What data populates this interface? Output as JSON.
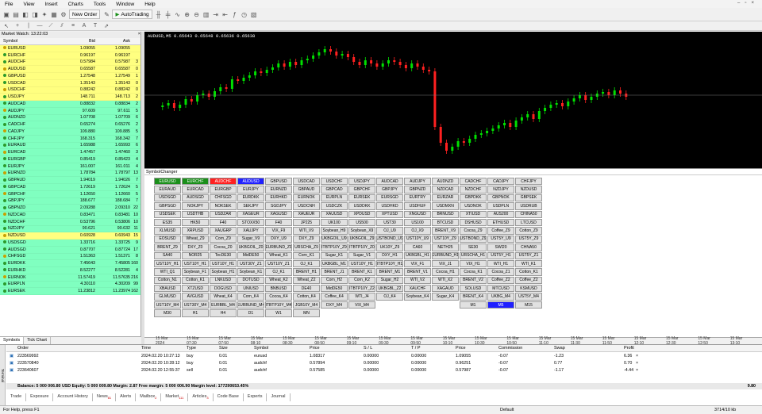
{
  "menu": [
    "File",
    "View",
    "Insert",
    "Charts",
    "Tools",
    "Window",
    "Help"
  ],
  "toolbar": {
    "new_order": "New Order",
    "autotrading": "AutoTrading"
  },
  "market_watch": {
    "title": "Market Watch: 13:22:03",
    "cols": [
      "Symbol",
      "Bid",
      "Ask",
      ""
    ],
    "rows": [
      [
        "EURUSD",
        "1.09055",
        "1.09055",
        "",
        "#ffff80"
      ],
      [
        "EURCHF",
        "0.96197",
        "0.96197",
        "",
        "#ffff80"
      ],
      [
        "AUDCHF",
        "0.57984",
        "0.57987",
        "3",
        "#ffff80"
      ],
      [
        "AUDUSD",
        "0.65587",
        "0.65587",
        "0",
        "#ffff80"
      ],
      [
        "GBPUSD",
        "1.27548",
        "1.27549",
        "1",
        "#ffff80"
      ],
      [
        "USDCAD",
        "1.35143",
        "1.35143",
        "0",
        "#ffff80"
      ],
      [
        "USDCHF",
        "0.88242",
        "0.88242",
        "0",
        "#ffff80"
      ],
      [
        "USDJPY",
        "148.711",
        "148.713",
        "2",
        "#ffff80"
      ],
      [
        "AUDCAD",
        "0.88832",
        "0.88834",
        "2",
        "#80ffc0"
      ],
      [
        "AUDJPY",
        "97.609",
        "97.611",
        "5",
        "#80ffc0"
      ],
      [
        "AUDNZD",
        "1.07708",
        "1.07709",
        "6",
        "#80ffc0"
      ],
      [
        "CADCHF",
        "0.65274",
        "0.65276",
        "2",
        "#80ffc0"
      ],
      [
        "CADJPY",
        "109.880",
        "109.885",
        "5",
        "#80ffc0"
      ],
      [
        "CHFJPY",
        "168.315",
        "168.342",
        "7",
        "#80ffc0"
      ],
      [
        "EURAUD",
        "1.65988",
        "1.65993",
        "6",
        "#80ffc0"
      ],
      [
        "EURCAD",
        "1.47457",
        "1.47460",
        "3",
        "#80ffc0"
      ],
      [
        "EURGBP",
        "0.85419",
        "0.85423",
        "4",
        "#80ffc0"
      ],
      [
        "EURJPY",
        "161.007",
        "161.011",
        "4",
        "#80ffc0"
      ],
      [
        "EURNZD",
        "1.78784",
        "1.78797",
        "13",
        "#80ffc0"
      ],
      [
        "GBPAUD",
        "1.94019",
        "1.94026",
        "7",
        "#80ffc0"
      ],
      [
        "GBPCAD",
        "1.72619",
        "1.72624",
        "5",
        "#80ffc0"
      ],
      [
        "GBPCHF",
        "1.12650",
        "1.12660",
        "5",
        "#80ffc0"
      ],
      [
        "GBPJPY",
        "188.677",
        "188.684",
        "7",
        "#80ffc0"
      ],
      [
        "GBPNZD",
        "2.09288",
        "2.09310",
        "22",
        "#80ffc0"
      ],
      [
        "NZDCAD",
        "0.83471",
        "0.83481",
        "10",
        "#80ffc0"
      ],
      [
        "NZDCHF",
        "0.53796",
        "0.53806",
        "10",
        "#80ffc0"
      ],
      [
        "NZDJPY",
        "90.621",
        "90.632",
        "11",
        "#80ffc0"
      ],
      [
        "NZDUSD",
        "0.60928",
        "0.60943",
        "15",
        "#ffff80"
      ],
      [
        "USDSGD",
        "1.33716",
        "1.33725",
        "9",
        "#80ffc0"
      ],
      [
        "AUDSGD",
        "0.87707",
        "0.87724",
        "17",
        "#80ffc0"
      ],
      [
        "CHFSGD",
        "1.51363",
        "1.51371",
        "8",
        "#80ffc0"
      ],
      [
        "EURDKK",
        "7.45643",
        "7.45805",
        "160",
        "#80ffc0"
      ],
      [
        "EURHKD",
        "8.52277",
        "8.52281",
        "4",
        "#80ffc0"
      ],
      [
        "EURNOK",
        "11.57419",
        "11.57635",
        "216",
        "#80ffc0"
      ],
      [
        "EURPLN",
        "4.30110",
        "4.30209",
        "99",
        "#80ffc0"
      ],
      [
        "EURSEK",
        "11.23812",
        "11.23974",
        "162",
        "#80ffc0"
      ]
    ]
  },
  "mw_tabs": [
    "Symbols",
    "Tick Chart"
  ],
  "chart": {
    "title": "AUDUSD,M5  0.65643 0.65648 0.65636 0.65638"
  },
  "symbol_changer": {
    "title": "SymbolChanger",
    "buttons": [
      "EURUSD",
      "EURCHF",
      "AUDCHF",
      "AUDUSD",
      "GBPUSD",
      "USDCAD",
      "USDCHF",
      "USDJPY",
      "AUDCAD",
      "AUDJPY",
      "AUDNZD",
      "CADCHF",
      "CADJPY",
      "CHFJPY",
      "EURAUD",
      "EURCAD",
      "EURGBP",
      "EURJPY",
      "EURNZD",
      "GBPAUD",
      "GBPCAD",
      "GBPCHF",
      "GBPJPY",
      "GBPNZD",
      "NZDCAD",
      "NZDCHF",
      "NZDJPY",
      "NZDUSD",
      "USDSGD",
      "AUDSGD",
      "CHFSGD",
      "EURDKK",
      "EURHKD",
      "EURNOK",
      "EURPLN",
      "EURSEK",
      "EURSGD",
      "EURTRY",
      "EURZAR",
      "GBPDKK",
      "GBPNOK",
      "GBPSEK",
      "GBPSGD",
      "NOKJPY",
      "NOKSEK",
      "SEKJPY",
      "SGDJPY",
      "USDCNH",
      "USDCZK",
      "USDDKK",
      "USDHKD",
      "USDHUF",
      "USDMXN",
      "USDNOK",
      "USDPLN",
      "USDRUB",
      "USDSEK",
      "USDTHB",
      "USDZAR",
      "XAGEUR",
      "XAGUSD",
      "XAUEUR",
      "XAUUSD",
      "XPDUSD",
      "XPTUSD",
      "XNGUSD",
      "BRNUSD",
      "XTIUSD",
      "AUS200",
      "CHINA50",
      "ES35",
      "HK50",
      "F40",
      "STOXX50",
      "F40",
      "JP225",
      "UK100",
      "US500",
      "UST30",
      "US100",
      "BTCUSD",
      "DSHUSD",
      "ETHUSD",
      "LTCUSD",
      "XLMUSD",
      "XRPUSD",
      "XAUGRP",
      "XAUJPY",
      "VIX_F9",
      "WTI_V9",
      "Soybean_H9",
      "Soybean_X9",
      "OJ_U9",
      "OJ_X9",
      "BRENT_V9",
      "Cocoa_Z9",
      "Coffee_Z9",
      "Cotton_Z9",
      "EOSUSD",
      "Wheat_Z9",
      "Corn_Z9",
      "Sugar_V9",
      "DXY_U9",
      "DXY_Z9",
      "UKBGOIL_U9",
      "UKBGOIL_Z9",
      "USTBOND_U9",
      "UST10Y_U9",
      "UST10Y_Z9",
      "USTBOND_Z9",
      "UST5Y_U9",
      "UST5Y_Z9",
      "BRENT_Z9",
      "DXY_Z0",
      "Cocoa_Z0",
      "UKBGOIL_Z0",
      "EURBUND_Z9",
      "URSCHA_Z9",
      "ITBTP10Y_Z9",
      "ITBTP10Y_Z0",
      "UK10Y_Z9",
      "CA60",
      "NETH25",
      "SE30",
      "SWI20",
      "CHNA50",
      "SA40",
      "NOR25",
      "TecDE30",
      "MidDE50",
      "Wheat_K1",
      "Corn_K1",
      "Sugar_K1",
      "Sugar_V1",
      "DXY_H1",
      "UKBGBL_H1",
      "EURBUND_H1",
      "URSCHA_H1",
      "UST5Y_H1",
      "UST5Y_Z1",
      "UST10Y_H1",
      "UST10Y_H1",
      "UST10Y_H1",
      "UST30Y_Z1",
      "UST10Y_Z1",
      "OJ_K1",
      "UKBGBL_M1",
      "UST10Y_H1",
      "ITBTP10Y_H1",
      "VIX_F1",
      "VIX_J1",
      "VIX_H1",
      "WTI_H1",
      "WTI_K1",
      "WTI_Q1",
      "Soybean_F1",
      "Soybean_H1",
      "Soybean_K1",
      "OJ_K1",
      "BRENT_H1",
      "BRENT_J1",
      "BRENT_K1",
      "BRENT_M1",
      "BRENT_V1",
      "Cocoa_H1",
      "Cocoa_K1",
      "Cocoa_Z1",
      "Cotton_K1",
      "Cotton_N1",
      "Cotton_K1",
      "LNKUSD",
      "DOTUSD",
      "Wheat_K2",
      "Wheat_Z2",
      "Corn_H2",
      "Corn_K2",
      "Sugar_H2",
      "WTI_V2",
      "WTI_X2",
      "BRENT_V2",
      "Coffee_Z2",
      "Coffee_Z2",
      "XBAUSD",
      "XTZUSD",
      "DOGUSD",
      "UNIUSD",
      "BNBUSD",
      "DE40",
      "MidDE50",
      "ITBTP10Y_Z2",
      "UKBGBL_Z2",
      "XAUCHF",
      "XAGAUD",
      "SOLUSD",
      "MTCUSD",
      "KSMUSD",
      "GLMUSD",
      "AVGUSD",
      "Wheat_K4",
      "Corn_K4",
      "Cocoa_K4",
      "Cotton_K4",
      "Coffee_K4",
      "WTI_J4",
      "OJ_K4",
      "Soybean_K4",
      "Sugar_K4",
      "BRENT_K4",
      "UKBG_M4",
      "UST5Y_M4",
      "UST10Y_M4",
      "UST30Y_M4",
      "EURBBL_M4",
      "EURBUND_M4",
      "ITBTP10Y_M4",
      "JGB10Y_M4",
      "DXY_M4",
      "VIX_M4",
      "",
      "",
      "",
      "M1",
      "M5",
      "M15",
      "M30",
      "H1",
      "H4",
      "D1",
      "W1",
      "MN"
    ]
  },
  "time_axis": [
    "15 Mar 2024",
    "15 Mar 07:30",
    "15 Mar 07:50",
    "15 Mar 08:10",
    "15 Mar 08:30",
    "15 Mar 08:50",
    "15 Mar 09:10",
    "15 Mar 09:30",
    "15 Mar 09:50",
    "15 Mar 10:10",
    "15 Mar 10:30",
    "15 Mar 10:50",
    "15 Mar 11:10",
    "15 Mar 11:30",
    "15 Mar 11:50",
    "15 Mar 12:10",
    "15 Mar 12:30",
    "15 Mar 12:50",
    "15 Mar 13:10"
  ],
  "terminal": {
    "side": "Terminal",
    "cols": [
      "Order",
      "Time",
      "Type",
      "Size",
      "Symbol",
      "Price",
      "S / L",
      "T / P",
      "Price",
      "Commission",
      "Swap",
      "Profit"
    ],
    "rows": [
      [
        "223569992",
        "2024.02.20 10:27:13",
        "buy",
        "0.01",
        "eurusd",
        "1.08317",
        "0.00000",
        "0.00000",
        "1.09055",
        "-0.07",
        "-1.23",
        "6.36"
      ],
      [
        "223570840",
        "2024.02.20 10:28:12",
        "buy",
        "0.01",
        "audchf",
        "0.57894",
        "0.00000",
        "0.00000",
        "0.96251",
        "-0.07",
        "0.77",
        "0.70"
      ],
      [
        "223640607",
        "2024.02.20 12:55:37",
        "sell",
        "0.01",
        "audchf",
        "0.57585",
        "0.00000",
        "0.00000",
        "0.57987",
        "-0.07",
        "-1.17",
        "-4.44"
      ]
    ],
    "balance": "Balance: 5 000 006.80 USD  Equity: 5 000 009.80  Margin: 2.87  Free margin: 5 000 006.90  Margin level: 177290653.45%",
    "total": "9.80",
    "tabs": [
      "Trade",
      "Exposure",
      "Account History",
      "News",
      "Alerts",
      "Mailbox",
      "Market",
      "Articles",
      "Code Base",
      "Experts",
      "Journal"
    ],
    "badges": [
      "81",
      "2",
      "111",
      "3"
    ]
  },
  "status": {
    "help": "For Help, press F1",
    "profile": "Default",
    "net": "3714/10 kb"
  },
  "colors": {
    "green_btn": "#1a8f1a",
    "red_btn": "#ff2020",
    "blue_btn": "#2020ff",
    "bull": "#00e000",
    "bear": "#ff2020"
  }
}
